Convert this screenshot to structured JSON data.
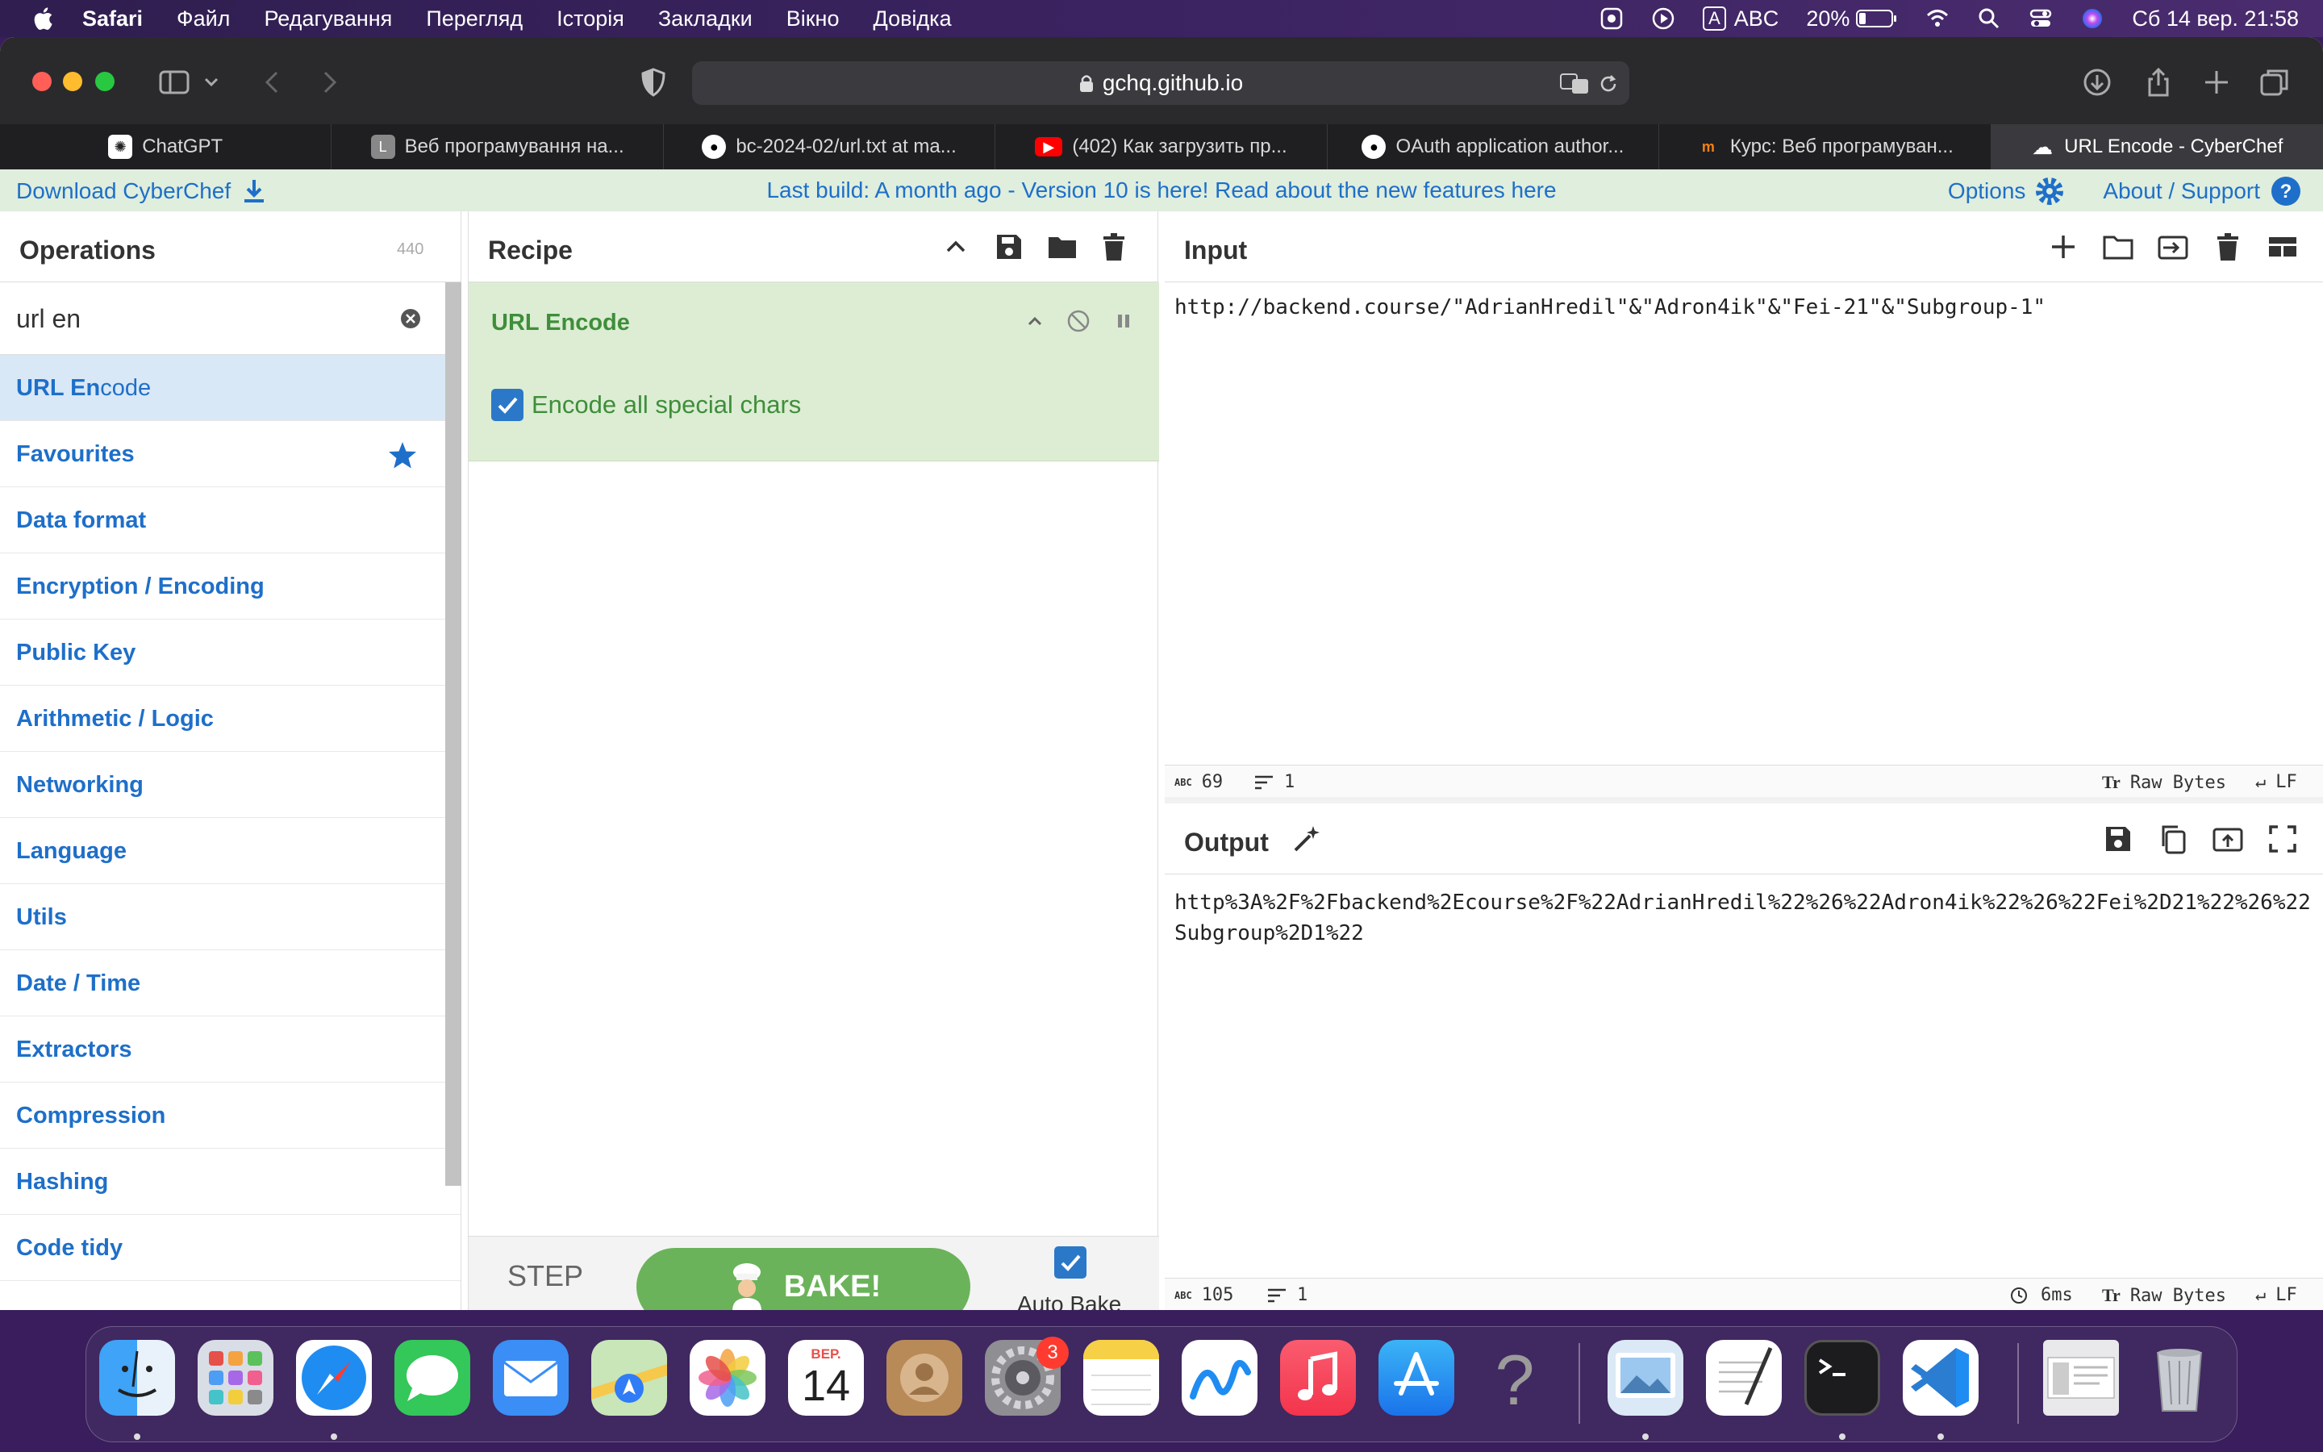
{
  "menubar": {
    "app_name": "Safari",
    "items": [
      "Файл",
      "Редагування",
      "Перегляд",
      "Історія",
      "Закладки",
      "Вікно",
      "Довідка"
    ],
    "input_source": "ABC",
    "input_letter": "A",
    "battery": "20%",
    "clock": "Сб 14 вер.  21:58"
  },
  "browser": {
    "url": "gchq.github.io",
    "tabs": [
      {
        "title": "ChatGPT",
        "icon": "chatgpt-icon",
        "active": false
      },
      {
        "title": "Веб програмування на...",
        "icon": "l-letter-icon",
        "active": false
      },
      {
        "title": "bc-2024-02/url.txt at ma...",
        "icon": "github-icon",
        "active": false
      },
      {
        "title": "(402) Как загрузить пр...",
        "icon": "youtube-icon",
        "active": false
      },
      {
        "title": "OAuth application author...",
        "icon": "github-icon",
        "active": false
      },
      {
        "title": "Курс: Веб програмуван...",
        "icon": "moodle-icon",
        "active": false
      },
      {
        "title": "URL Encode - CyberChef",
        "icon": "cyberchef-icon",
        "active": true
      }
    ]
  },
  "banner": {
    "download": "Download CyberChef",
    "message": "Last build: A month ago - Version 10 is here! Read about the new features here",
    "options": "Options",
    "about": "About / Support"
  },
  "operations": {
    "title": "Operations",
    "count": "440",
    "search_value": "url en",
    "match_prefix": "URL En",
    "match_suffix": "code",
    "categories": [
      "Favourites",
      "Data format",
      "Encryption / Encoding",
      "Public Key",
      "Arithmetic / Logic",
      "Networking",
      "Language",
      "Utils",
      "Date / Time",
      "Extractors",
      "Compression",
      "Hashing",
      "Code tidy"
    ]
  },
  "recipe": {
    "title": "Recipe",
    "operation_name": "URL Encode",
    "option_label": "Encode all special chars",
    "option_checked": true,
    "step_label": "STEP",
    "bake_label": "BAKE!",
    "auto_bake_label": "Auto Bake",
    "auto_bake_checked": true
  },
  "input": {
    "title": "Input",
    "text": "http://backend.course/\"AdrianHredil\"&\"Adron4ik\"&\"Fei-21\"&\"Subgroup-1\"",
    "length": "69",
    "lines": "1",
    "encoding": "Raw Bytes",
    "eol": "LF",
    "length_icon": "ABC"
  },
  "output": {
    "title": "Output",
    "text": "http%3A%2F%2Fbackend%2Ecourse%2F%22AdrianHredil%22%26%22Adron4ik%22%26%22Fei%2D21%22%26%22Subgroup%2D1%22",
    "length": "105",
    "lines": "1",
    "time": "6ms",
    "encoding": "Raw Bytes",
    "eol": "LF",
    "length_icon": "ABC"
  },
  "dock": {
    "calendar_month": "ВЕР.",
    "calendar_day": "14",
    "settings_badge": "3",
    "apps": [
      "Finder",
      "Launchpad",
      "Safari",
      "Messages",
      "Mail",
      "Maps",
      "Photos",
      "Calendar",
      "Contacts",
      "System Settings",
      "Notes",
      "Freeform",
      "Music",
      "App Store",
      "Help",
      "Preview",
      "TextEdit",
      "Terminal",
      "Visual Studio Code",
      "Screenshot",
      "Trash"
    ]
  },
  "colors": {
    "accent_blue": "#1e6fc9",
    "recipe_green": "#3f8e3a",
    "bake_green": "#6bb35a",
    "banner_bg": "#dfeedd"
  }
}
